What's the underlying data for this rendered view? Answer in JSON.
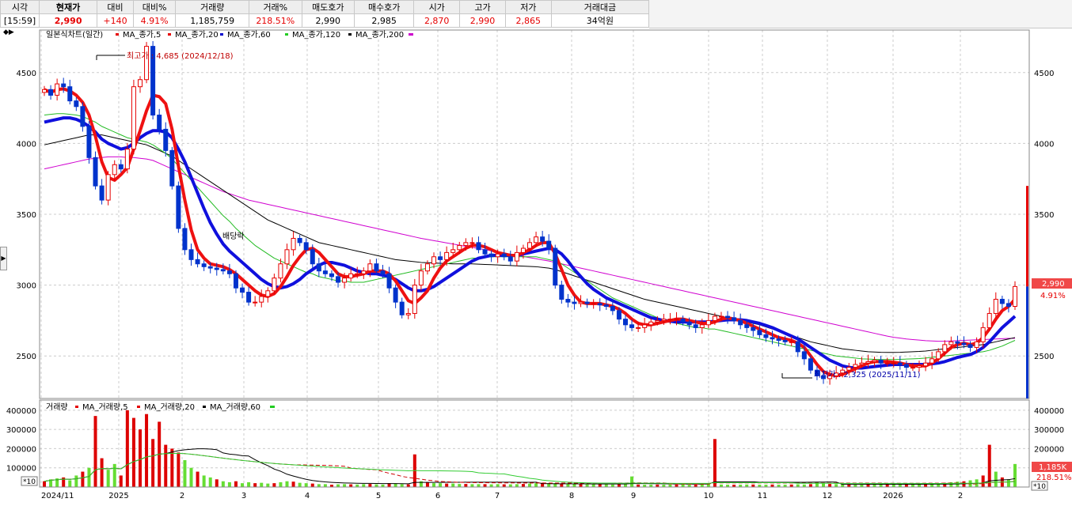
{
  "quote": {
    "headers": [
      "시각",
      "현재가",
      "대비",
      "대비%",
      "거래량",
      "거래%",
      "매도호가",
      "매수호가",
      "시가",
      "고가",
      "저가",
      "거래대금"
    ],
    "values": [
      "[15:59]",
      "2,990",
      "+140",
      "4.91%",
      "1,185,759",
      "218.51%",
      "2,990",
      "2,985",
      "2,870",
      "2,990",
      "2,865",
      "34억원"
    ]
  },
  "price_panel": {
    "legend": [
      {
        "text": "일본식차트(일간)",
        "color": "#000000"
      },
      {
        "text": "MA_종가,5",
        "color": "#e60000"
      },
      {
        "text": "MA_종가,20",
        "color": "#e60000"
      },
      {
        "text": "MA_종가,60",
        "color": "#0000cc"
      },
      {
        "text": "MA_종가,120",
        "color": "#00aa00"
      },
      {
        "text": "MA_종가,200",
        "color": "#000000"
      }
    ],
    "legend_marker_colors": [
      "#e60000",
      "#e60000",
      "#0000cc",
      "#22cc22",
      "#000000",
      "#cc00cc"
    ],
    "high_label": "최고가 : 4,685 (2024/12/18)",
    "low_label": "최저가 : 2,325 (2025/11/11)",
    "event_label": "배당락",
    "current_price": "2,990",
    "current_change": "4.91%",
    "tool_toggle": "◆▶"
  },
  "volume_panel": {
    "legend": [
      {
        "text": "거래량",
        "color": "#000000"
      },
      {
        "text": "MA_거래량,5",
        "color": "#e60000"
      },
      {
        "text": "MA_거래량,20",
        "color": "#000000"
      },
      {
        "text": "MA_거래량,60",
        "color": "#e60000"
      }
    ],
    "legend_marker_colors": [
      "#e60000",
      "#e60000",
      "#000000",
      "#22cc22"
    ],
    "unit": "*10",
    "current_volume": "1,185K",
    "current_volume_pct": "218.51%"
  },
  "chart_data": {
    "type": "candlestick",
    "x_axis_labels": [
      "2024/11",
      "2025",
      "2",
      "3",
      "4",
      "5",
      "6",
      "7",
      "8",
      "9",
      "10",
      "11",
      "12",
      "2026",
      "2"
    ],
    "price_axis": {
      "ticks": [
        2500,
        3000,
        3500,
        4000,
        4500
      ],
      "range": [
        2200,
        4800
      ]
    },
    "volume_axis": {
      "ticks": [
        100000,
        200000,
        300000,
        400000
      ],
      "range": [
        0,
        420000
      ]
    },
    "closes": [
      4380,
      4340,
      4420,
      4400,
      4300,
      4260,
      4120,
      3900,
      3700,
      3600,
      3780,
      3850,
      3820,
      3960,
      4400,
      4450,
      4685,
      4200,
      4100,
      3950,
      3700,
      3400,
      3250,
      3180,
      3150,
      3130,
      3120,
      3110,
      3100,
      3080,
      2980,
      2950,
      2880,
      2880,
      2920,
      2960,
      3050,
      3150,
      3250,
      3330,
      3300,
      3250,
      3150,
      3100,
      3080,
      3060,
      3020,
      3050,
      3080,
      3080,
      3100,
      3150,
      3100,
      3080,
      2980,
      2880,
      2790,
      2800,
      3000,
      3100,
      3150,
      3200,
      3180,
      3230,
      3250,
      3280,
      3300,
      3300,
      3250,
      3220,
      3200,
      3220,
      3200,
      3170,
      3230,
      3260,
      3300,
      3340,
      3310,
      3260,
      3000,
      2900,
      2880,
      2870,
      2880,
      2870,
      2870,
      2860,
      2850,
      2820,
      2760,
      2720,
      2700,
      2700,
      2720,
      2740,
      2750,
      2760,
      2760,
      2760,
      2740,
      2720,
      2700,
      2720,
      2750,
      2780,
      2780,
      2770,
      2750,
      2720,
      2700,
      2680,
      2650,
      2630,
      2620,
      2610,
      2600,
      2600,
      2530,
      2480,
      2400,
      2360,
      2340,
      2360,
      2380,
      2400,
      2420,
      2440,
      2450,
      2460,
      2470,
      2450,
      2450,
      2450,
      2440,
      2420,
      2420,
      2430,
      2450,
      2480,
      2530,
      2580,
      2600,
      2590,
      2580,
      2560,
      2600,
      2700,
      2800,
      2900,
      2870,
      2850,
      2990
    ],
    "ma5": [
      4380,
      4360,
      4380,
      4385,
      4370,
      4340,
      4290,
      4200,
      4050,
      3870,
      3760,
      3740,
      3780,
      3830,
      3960,
      4090,
      4230,
      4340,
      4330,
      4280,
      4100,
      3840,
      3600,
      3390,
      3250,
      3190,
      3150,
      3140,
      3130,
      3110,
      3080,
      3040,
      3000,
      2960,
      2930,
      2920,
      2940,
      2990,
      3060,
      3140,
      3200,
      3250,
      3260,
      3230,
      3180,
      3130,
      3080,
      3060,
      3060,
      3070,
      3080,
      3100,
      3100,
      3100,
      3080,
      3030,
      2960,
      2890,
      2870,
      2910,
      2960,
      3050,
      3120,
      3170,
      3200,
      3230,
      3260,
      3280,
      3280,
      3270,
      3250,
      3230,
      3220,
      3210,
      3210,
      3230,
      3250,
      3280,
      3300,
      3300,
      3220,
      3110,
      3000,
      2930,
      2880,
      2870,
      2870,
      2870,
      2860,
      2850,
      2830,
      2800,
      2760,
      2730,
      2720,
      2720,
      2730,
      2740,
      2750,
      2760,
      2760,
      2750,
      2740,
      2730,
      2730,
      2740,
      2760,
      2770,
      2760,
      2750,
      2730,
      2710,
      2690,
      2670,
      2650,
      2630,
      2620,
      2610,
      2590,
      2560,
      2500,
      2440,
      2390,
      2370,
      2360,
      2370,
      2390,
      2410,
      2430,
      2450,
      2460,
      2460,
      2460,
      2455,
      2450,
      2440,
      2430,
      2430,
      2430,
      2450,
      2480,
      2520,
      2560,
      2580,
      2590,
      2580,
      2590,
      2630,
      2690,
      2760,
      2820,
      2850,
      2900
    ],
    "ma20": [
      4150,
      4160,
      4170,
      4180,
      4180,
      4170,
      4150,
      4120,
      4080,
      4030,
      4000,
      3980,
      3960,
      3970,
      4000,
      4040,
      4070,
      4090,
      4090,
      4080,
      4040,
      3960,
      3870,
      3760,
      3650,
      3540,
      3440,
      3360,
      3290,
      3240,
      3200,
      3160,
      3120,
      3080,
      3040,
      3010,
      2990,
      2980,
      2990,
      3010,
      3040,
      3080,
      3110,
      3140,
      3160,
      3160,
      3150,
      3140,
      3120,
      3100,
      3090,
      3080,
      3080,
      3070,
      3060,
      3040,
      3010,
      2980,
      2960,
      2960,
      2970,
      2990,
      3020,
      3050,
      3080,
      3110,
      3140,
      3170,
      3190,
      3200,
      3210,
      3210,
      3210,
      3210,
      3210,
      3220,
      3230,
      3240,
      3250,
      3260,
      3250,
      3220,
      3170,
      3110,
      3060,
      3010,
      2970,
      2940,
      2910,
      2890,
      2870,
      2850,
      2830,
      2810,
      2790,
      2770,
      2760,
      2750,
      2745,
      2740,
      2740,
      2740,
      2740,
      2740,
      2740,
      2745,
      2750,
      2755,
      2755,
      2755,
      2750,
      2740,
      2730,
      2715,
      2700,
      2680,
      2660,
      2640,
      2620,
      2590,
      2560,
      2530,
      2500,
      2470,
      2450,
      2430,
      2420,
      2415,
      2415,
      2420,
      2425,
      2430,
      2435,
      2440,
      2440,
      2440,
      2440,
      2440,
      2440,
      2445,
      2450,
      2460,
      2475,
      2490,
      2500,
      2510,
      2530,
      2560,
      2600,
      2650,
      2700,
      2740,
      2780
    ],
    "ma120": [
      4200,
      4205,
      4210,
      4210,
      4205,
      4200,
      4190,
      4170,
      4150,
      4120,
      4100,
      4080,
      4060,
      4040,
      4030,
      4020,
      4010,
      3990,
      3960,
      3930,
      3890,
      3840,
      3790,
      3740,
      3690,
      3640,
      3590,
      3540,
      3490,
      3450,
      3400,
      3360,
      3320,
      3280,
      3250,
      3220,
      3190,
      3170,
      3150,
      3130,
      3110,
      3090,
      3080,
      3060,
      3050,
      3040,
      3030,
      3030,
      3020,
      3020,
      3020,
      3030,
      3040,
      3050,
      3060,
      3070,
      3080,
      3090,
      3100,
      3110,
      3120,
      3130,
      3140,
      3150,
      3160,
      3170,
      3180,
      3190,
      3190,
      3200,
      3200,
      3200,
      3200,
      3200,
      3200,
      3200,
      3200,
      3200,
      3190,
      3180,
      3170,
      3150,
      3120,
      3090,
      3060,
      3030,
      3000,
      2970,
      2940,
      2910,
      2890,
      2870,
      2850,
      2830,
      2810,
      2790,
      2770,
      2750,
      2740,
      2730,
      2720,
      2710,
      2700,
      2700,
      2690,
      2690,
      2680,
      2670,
      2660,
      2650,
      2640,
      2630,
      2620,
      2610,
      2600,
      2590,
      2580,
      2570,
      2560,
      2550,
      2540,
      2530,
      2520,
      2510,
      2500,
      2495,
      2490,
      2485,
      2480,
      2478,
      2476,
      2475,
      2475,
      2475,
      2476,
      2478,
      2480,
      2482,
      2485,
      2490,
      2495,
      2500,
      2505,
      2510,
      2515,
      2520,
      2525,
      2530,
      2540,
      2555,
      2570,
      2590,
      2610
    ],
    "ma200": [
      3990,
      4000,
      4010,
      4020,
      4030,
      4040,
      4050,
      4060,
      4060,
      4060,
      4050,
      4040,
      4030,
      4020,
      4010,
      4000,
      3990,
      3970,
      3950,
      3930,
      3910,
      3880,
      3850,
      3820,
      3790,
      3760,
      3730,
      3700,
      3670,
      3640,
      3610,
      3580,
      3550,
      3520,
      3490,
      3460,
      3440,
      3420,
      3400,
      3380,
      3360,
      3340,
      3320,
      3300,
      3290,
      3280,
      3270,
      3260,
      3250,
      3240,
      3230,
      3220,
      3210,
      3200,
      3190,
      3180,
      3175,
      3170,
      3165,
      3160,
      3158,
      3156,
      3154,
      3152,
      3150,
      3150,
      3150,
      3150,
      3148,
      3146,
      3144,
      3142,
      3140,
      3138,
      3136,
      3134,
      3132,
      3130,
      3125,
      3120,
      3110,
      3095,
      3080,
      3065,
      3050,
      3035,
      3020,
      3005,
      2990,
      2975,
      2960,
      2945,
      2930,
      2915,
      2900,
      2890,
      2880,
      2870,
      2860,
      2850,
      2840,
      2830,
      2820,
      2810,
      2800,
      2790,
      2780,
      2770,
      2760,
      2750,
      2740,
      2730,
      2720,
      2705,
      2690,
      2675,
      2660,
      2645,
      2630,
      2615,
      2600,
      2590,
      2580,
      2570,
      2560,
      2550,
      2545,
      2540,
      2535,
      2530,
      2528,
      2526,
      2525,
      2525,
      2526,
      2528,
      2530,
      2532,
      2535,
      2540,
      2545,
      2550,
      2555,
      2560,
      2565,
      2570,
      2575,
      2580,
      2590,
      2600,
      2610,
      2620,
      2630
    ],
    "ma_magenta": [
      3820,
      3830,
      3840,
      3850,
      3860,
      3870,
      3880,
      3890,
      3895,
      3900,
      3905,
      3905,
      3905,
      3900,
      3900,
      3895,
      3890,
      3880,
      3860,
      3840,
      3820,
      3800,
      3780,
      3760,
      3740,
      3720,
      3700,
      3680,
      3660,
      3645,
      3630,
      3615,
      3600,
      3590,
      3580,
      3570,
      3560,
      3550,
      3540,
      3530,
      3520,
      3510,
      3500,
      3490,
      3480,
      3470,
      3460,
      3450,
      3440,
      3430,
      3420,
      3410,
      3400,
      3390,
      3380,
      3370,
      3360,
      3350,
      3340,
      3330,
      3322,
      3314,
      3306,
      3298,
      3290,
      3282,
      3274,
      3266,
      3258,
      3250,
      3242,
      3234,
      3226,
      3218,
      3210,
      3202,
      3194,
      3186,
      3178,
      3170,
      3160,
      3150,
      3140,
      3130,
      3120,
      3110,
      3100,
      3090,
      3080,
      3070,
      3060,
      3050,
      3040,
      3030,
      3020,
      3010,
      3000,
      2990,
      2980,
      2970,
      2960,
      2950,
      2940,
      2930,
      2920,
      2910,
      2900,
      2890,
      2880,
      2870,
      2860,
      2850,
      2840,
      2830,
      2820,
      2810,
      2800,
      2790,
      2780,
      2770,
      2760,
      2750,
      2740,
      2730,
      2720,
      2710,
      2700,
      2690,
      2680,
      2670,
      2660,
      2650,
      2640,
      2632,
      2626,
      2620,
      2616,
      2612,
      2608,
      2606,
      2604,
      2604,
      2606,
      2608,
      2610,
      2612,
      2614,
      2616,
      2618,
      2620,
      2622,
      2624,
      2625
    ],
    "volumes": [
      30000,
      40000,
      45000,
      50000,
      35000,
      60000,
      80000,
      100000,
      370000,
      150000,
      90000,
      120000,
      60000,
      400000,
      360000,
      300000,
      380000,
      250000,
      340000,
      220000,
      200000,
      180000,
      140000,
      100000,
      80000,
      60000,
      50000,
      40000,
      30000,
      25000,
      30000,
      20000,
      25000,
      20000,
      22000,
      18000,
      20000,
      25000,
      30000,
      28000,
      22000,
      20000,
      18000,
      15000,
      15000,
      12000,
      14000,
      15000,
      14000,
      13000,
      15000,
      16000,
      14000,
      13000,
      20000,
      18000,
      15000,
      14000,
      170000,
      30000,
      25000,
      20000,
      20000,
      18000,
      18000,
      16000,
      16000,
      15000,
      15000,
      15000,
      14000,
      15000,
      14000,
      14000,
      15000,
      16000,
      18000,
      20000,
      22000,
      20000,
      20000,
      18000,
      16000,
      15000,
      14000,
      14000,
      14000,
      15000,
      14000,
      13000,
      14000,
      14000,
      55000,
      13000,
      12000,
      12000,
      13000,
      12000,
      13000,
      13000,
      14000,
      12000,
      12000,
      15000,
      20000,
      250000,
      13000,
      12000,
      12000,
      12000,
      13000,
      13000,
      12000,
      12000,
      13000,
      12000,
      12000,
      13000,
      14000,
      13000,
      15000,
      25000,
      18000,
      16000,
      15000,
      14000,
      14000,
      13000,
      13000,
      14000,
      13000,
      13000,
      14000,
      14000,
      13000,
      13000,
      14000,
      15000,
      16000,
      18000,
      20000,
      22000,
      25000,
      28000,
      30000,
      35000,
      40000,
      60000,
      220000,
      80000,
      50000,
      40000,
      120000
    ]
  }
}
